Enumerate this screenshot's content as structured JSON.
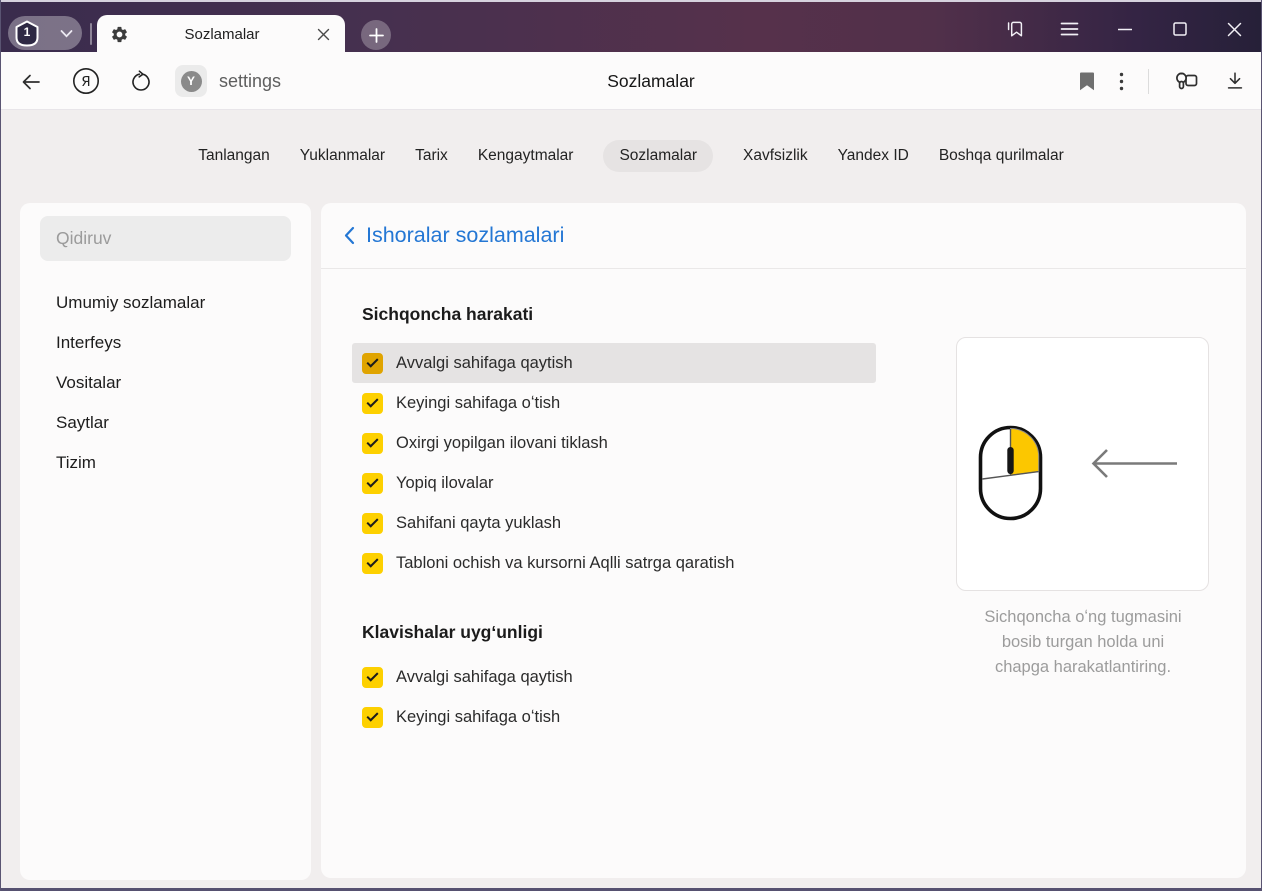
{
  "colors": {
    "accent_yellow": "#fdd000",
    "accent_yellow_active": "#e0a400",
    "row_highlight": "#e5e3e3",
    "link_blue": "#2477d4",
    "titlebar_gradient": [
      "#3a2c4d",
      "#56314b",
      "#262038"
    ]
  },
  "titlebar": {
    "profile_badge": "1",
    "tab_title": "Sozlamalar"
  },
  "toolbar": {
    "url": "settings",
    "page_title": "Sozlamalar",
    "favicon_letter": "Y",
    "logo_letter": "Я"
  },
  "nav": {
    "tabs": [
      {
        "label": "Tanlangan",
        "active": false
      },
      {
        "label": "Yuklanmalar",
        "active": false
      },
      {
        "label": "Tarix",
        "active": false
      },
      {
        "label": "Kengaytmalar",
        "active": false
      },
      {
        "label": "Sozlamalar",
        "active": true
      },
      {
        "label": "Xavfsizlik",
        "active": false
      },
      {
        "label": "Yandex ID",
        "active": false
      },
      {
        "label": "Boshqa qurilmalar",
        "active": false
      }
    ]
  },
  "sidebar": {
    "search_placeholder": "Qidiruv",
    "items": [
      {
        "label": "Umumiy sozlamalar"
      },
      {
        "label": "Interfeys"
      },
      {
        "label": "Vositalar"
      },
      {
        "label": "Saytlar"
      },
      {
        "label": "Tizim"
      }
    ]
  },
  "main": {
    "back_header": "Ishoralar sozlamalari",
    "mouse_section": {
      "heading": "Sichqoncha harakati",
      "items": [
        {
          "label": "Avvalgi sahifaga qaytish",
          "checked": true,
          "highlighted": true
        },
        {
          "label": "Keyingi sahifaga oʻtish",
          "checked": true,
          "highlighted": false
        },
        {
          "label": "Oxirgi yopilgan ilovani tiklash",
          "checked": true,
          "highlighted": false
        },
        {
          "label": "Yopiq ilovalar",
          "checked": true,
          "highlighted": false
        },
        {
          "label": "Sahifani qayta yuklash",
          "checked": true,
          "highlighted": false
        },
        {
          "label": "Tabloni ochish va kursorni Aqlli satrga qaratish",
          "checked": true,
          "highlighted": false
        }
      ]
    },
    "keys_section": {
      "heading": "Klavishalar uygʻunligi",
      "items": [
        {
          "label": "Avvalgi sahifaga qaytish",
          "checked": true
        },
        {
          "label": "Keyingi sahifaga oʻtish",
          "checked": true
        }
      ]
    },
    "illustration_caption_lines": [
      "Sichqoncha oʻng tugmasini",
      "bosib turgan holda uni",
      "chapga harakatlantiring."
    ]
  }
}
